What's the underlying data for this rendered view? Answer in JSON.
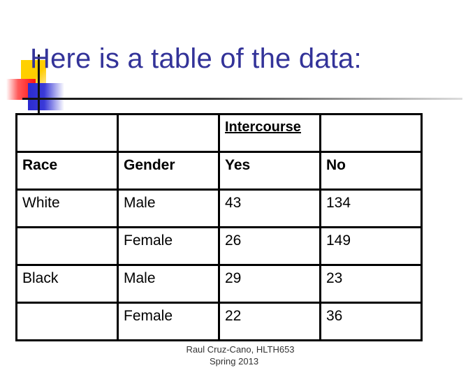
{
  "slide": {
    "title": "Here is a table of the data:",
    "footer_line1": "Raul Cruz-Cano, HLTH653",
    "footer_line2": "Spring 2013"
  },
  "table": {
    "group_header": "Intercourse",
    "headers": [
      "Race",
      "Gender",
      "Yes",
      "No"
    ],
    "rows": [
      {
        "race": "White",
        "gender": "Male",
        "yes": "43",
        "no": "134"
      },
      {
        "race": "",
        "gender": "Female",
        "yes": "26",
        "no": "149"
      },
      {
        "race": "Black",
        "gender": "Male",
        "yes": "29",
        "no": "23"
      },
      {
        "race": "",
        "gender": "Female",
        "yes": "22",
        "no": "36"
      }
    ]
  },
  "colors": {
    "title": "#333399",
    "accent_yellow": "#ffcc00",
    "accent_red": "#ff1010",
    "accent_blue": "#2b2bd0"
  }
}
